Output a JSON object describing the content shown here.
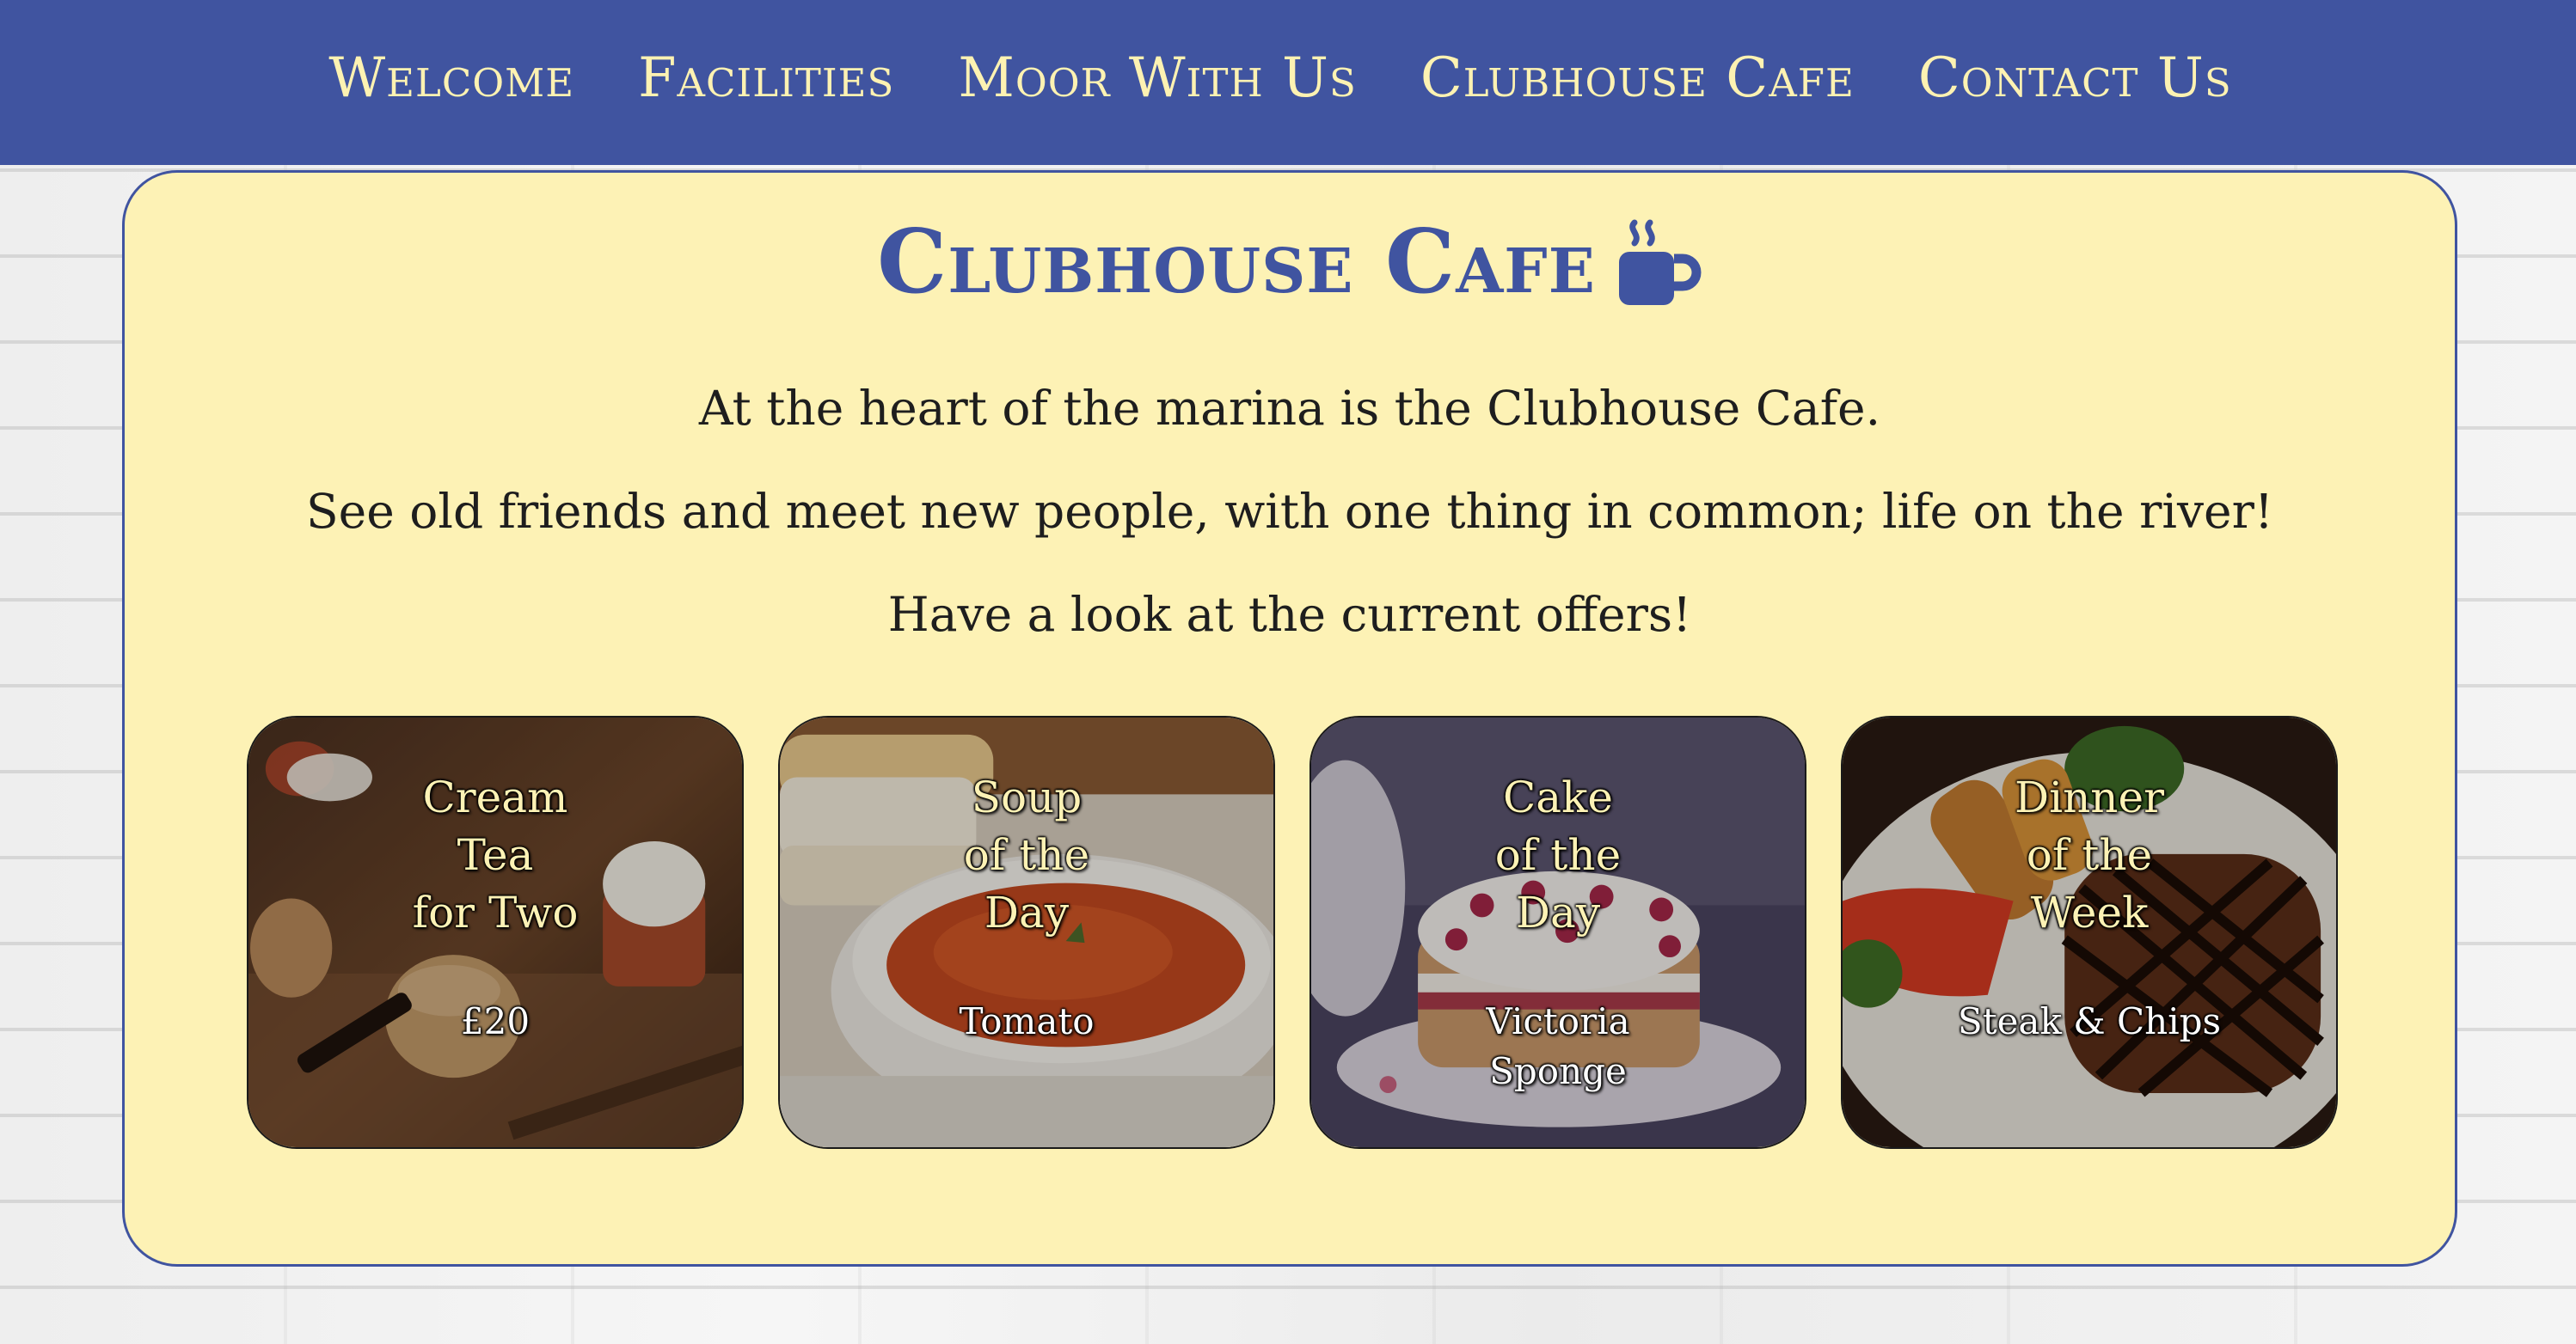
{
  "nav": {
    "items": [
      "Welcome",
      "Facilities",
      "Moor With Us",
      "Clubhouse Cafe",
      "Contact Us"
    ]
  },
  "page": {
    "title": "Clubhouse Cafe",
    "title_icon": "coffee-cup-icon",
    "intro": [
      "At the heart of the marina is the Clubhouse Cafe.",
      "See old friends and meet new people, with one thing in common; life on the river!",
      "Have a look at the current offers!"
    ]
  },
  "offers": [
    {
      "title": "Cream\nTea\nfor Two",
      "detail": "£20",
      "image": "scones-and-cream-photo"
    },
    {
      "title": "Soup\nof the\nDay",
      "detail": "Tomato",
      "image": "tomato-soup-photo"
    },
    {
      "title": "Cake\nof the\nDay",
      "detail": "Victoria\nSponge",
      "image": "victoria-sponge-photo"
    },
    {
      "title": "Dinner\nof the\nWeek",
      "detail": "Steak & Chips",
      "image": "steak-dinner-photo"
    }
  ],
  "colors": {
    "nav_background": "#4054a0",
    "nav_text": "#fdf2b2",
    "panel_background": "#fdf2b5",
    "accent": "#4054a0",
    "body_text": "#1e1e1e"
  }
}
